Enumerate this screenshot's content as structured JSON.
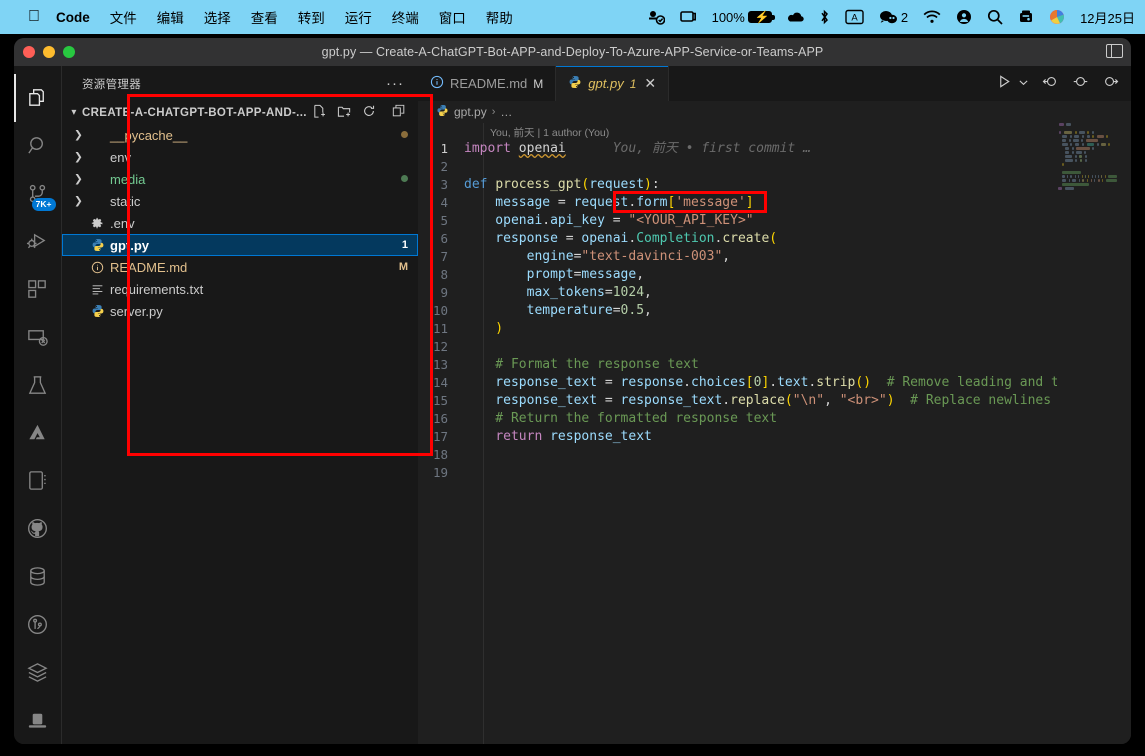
{
  "menubar": {
    "apple_icon": "apple-icon",
    "items": [
      "Code",
      "文件",
      "编辑",
      "选择",
      "查看",
      "转到",
      "运行",
      "终端",
      "窗口",
      "帮助"
    ],
    "status": {
      "control_center_icon": "control-center-icon",
      "display_icon": "display-icon",
      "battery_percent": "100%",
      "battery_icon": "battery-charging-icon",
      "dropbox_icon": "cloud-icon",
      "bluetooth_icon": "bluetooth-icon",
      "input_source": "A",
      "wechat_icon": "wechat-icon",
      "wechat_count": "2",
      "wifi_icon": "wifi-icon",
      "user_icon": "user-icon",
      "search_icon": "search-icon",
      "siri_icon": "siri-icon",
      "colorwheel_icon": "color-wheel-icon",
      "date": "12月25日"
    }
  },
  "window": {
    "title": "gpt.py — Create-A-ChatGPT-Bot-APP-and-Deploy-To-Azure-APP-Service-or-Teams-APP",
    "layout_icon": "editor-layout-icon"
  },
  "activitybar": {
    "items": [
      {
        "name": "explorer",
        "icon": "files-icon",
        "active": true,
        "badge": ""
      },
      {
        "name": "search",
        "icon": "search-icon",
        "active": false,
        "badge": ""
      },
      {
        "name": "source-control",
        "icon": "source-control-icon",
        "active": false,
        "badge": "7K+"
      },
      {
        "name": "run-and-debug",
        "icon": "debug-icon",
        "active": false,
        "badge": ""
      },
      {
        "name": "extensions",
        "icon": "extensions-icon",
        "active": false,
        "badge": ""
      },
      {
        "name": "remote-explorer",
        "icon": "remote-icon",
        "active": false,
        "badge": ""
      },
      {
        "name": "testing",
        "icon": "beaker-icon",
        "active": false,
        "badge": ""
      },
      {
        "name": "azure",
        "icon": "azure-icon",
        "active": false,
        "badge": ""
      },
      {
        "name": "notebook",
        "icon": "notebook-icon",
        "active": false,
        "badge": ""
      },
      {
        "name": "github",
        "icon": "github-icon",
        "active": false,
        "badge": ""
      },
      {
        "name": "database",
        "icon": "database-icon",
        "active": false,
        "badge": ""
      },
      {
        "name": "git-graph",
        "icon": "git-graph-icon",
        "active": false,
        "badge": ""
      },
      {
        "name": "layers",
        "icon": "layers-icon",
        "active": false,
        "badge": ""
      },
      {
        "name": "remote-desktop",
        "icon": "remote-desktop-icon",
        "active": false,
        "badge": ""
      }
    ]
  },
  "sidebar": {
    "title": "资源管理器",
    "more_actions": "···",
    "folder_name": "CREATE-A-CHATGPT-BOT-APP-AND-...",
    "folder_actions": [
      "new-file-icon",
      "new-folder-icon",
      "refresh-icon",
      "collapse-all-icon"
    ],
    "files": [
      {
        "label": "__pycache__",
        "type": "folder",
        "icon": "folder-arrow",
        "badge": "",
        "badge_kind": "dot-yellow",
        "selected": false,
        "color": "#e2c08d"
      },
      {
        "label": "env",
        "type": "folder",
        "icon": "folder-arrow",
        "badge": "",
        "badge_kind": "",
        "selected": false,
        "color": "#cccccc"
      },
      {
        "label": "media",
        "type": "folder",
        "icon": "folder-arrow",
        "badge": "",
        "badge_kind": "dot-green",
        "selected": false,
        "color": "#73c991"
      },
      {
        "label": "static",
        "type": "folder",
        "icon": "folder-arrow",
        "badge": "",
        "badge_kind": "",
        "selected": false,
        "color": "#cccccc"
      },
      {
        "label": ".env",
        "type": "file",
        "icon": "gear-icon",
        "badge": "",
        "badge_kind": "",
        "selected": false,
        "color": "#cccccc"
      },
      {
        "label": "gpt.py",
        "type": "file",
        "icon": "python-icon",
        "badge": "1",
        "badge_kind": "text",
        "selected": true,
        "color": "#ffffff"
      },
      {
        "label": "README.md",
        "type": "file",
        "icon": "info-icon",
        "badge": "M",
        "badge_kind": "text",
        "selected": false,
        "color": "#e2c08d"
      },
      {
        "label": "requirements.txt",
        "type": "file",
        "icon": "list-icon",
        "badge": "",
        "badge_kind": "",
        "selected": false,
        "color": "#cccccc"
      },
      {
        "label": "server.py",
        "type": "file",
        "icon": "python-icon",
        "badge": "",
        "badge_kind": "",
        "selected": false,
        "color": "#cccccc"
      }
    ]
  },
  "tabs": [
    {
      "label": "README.md",
      "icon": "info-icon",
      "status": "M",
      "active": false,
      "closable": false
    },
    {
      "label": "gpt.py",
      "icon": "python-icon",
      "status": "1",
      "active": true,
      "closable": true,
      "close_icon": "close-icon"
    }
  ],
  "tab_actions": [
    {
      "name": "run-python-file",
      "icon": "play-icon"
    },
    {
      "name": "run-dropdown",
      "icon": "chevron-down-icon"
    },
    {
      "name": "step-back",
      "icon": "step-back-icon"
    },
    {
      "name": "step-over",
      "icon": "step-over-icon"
    },
    {
      "name": "step-into",
      "icon": "step-into-icon"
    }
  ],
  "breadcrumb": {
    "file": "gpt.py",
    "separator": "›",
    "rest": "…",
    "icon": "python-icon"
  },
  "blame_header": "You, 前天 | 1 author (You)",
  "inline_blame": "You, 前天 • first commit …",
  "annotations": {
    "sidebar_box_color": "#ff0000",
    "apikey_box_color": "#ff0000"
  },
  "code": {
    "language": "python",
    "lines": [
      {
        "n": "1",
        "tokens": [
          {
            "t": "import",
            "c": "kw"
          },
          {
            "t": " ",
            "c": "plain"
          },
          {
            "t": "openai",
            "c": "squig-plain"
          }
        ],
        "blame": true
      },
      {
        "n": "2",
        "tokens": []
      },
      {
        "n": "3",
        "tokens": [
          {
            "t": "def",
            "c": "kw2"
          },
          {
            "t": " ",
            "c": "plain"
          },
          {
            "t": "process_gpt",
            "c": "fn"
          },
          {
            "t": "(",
            "c": "pun"
          },
          {
            "t": "request",
            "c": "var"
          },
          {
            "t": ")",
            "c": "pun"
          },
          {
            "t": ":",
            "c": "plain"
          }
        ]
      },
      {
        "n": "4",
        "tokens": [
          {
            "t": "    message",
            "c": "var"
          },
          {
            "t": " = ",
            "c": "plain"
          },
          {
            "t": "request",
            "c": "var"
          },
          {
            "t": ".",
            "c": "plain"
          },
          {
            "t": "form",
            "c": "var"
          },
          {
            "t": "[",
            "c": "pun"
          },
          {
            "t": "'message'",
            "c": "str"
          },
          {
            "t": "]",
            "c": "pun"
          }
        ]
      },
      {
        "n": "5",
        "tokens": [
          {
            "t": "    openai",
            "c": "var"
          },
          {
            "t": ".",
            "c": "plain"
          },
          {
            "t": "api_key",
            "c": "var"
          },
          {
            "t": " = ",
            "c": "plain"
          },
          {
            "t": "\"<YOUR_API_KEY>\"",
            "c": "str"
          }
        ]
      },
      {
        "n": "6",
        "tokens": [
          {
            "t": "    response",
            "c": "var"
          },
          {
            "t": " = ",
            "c": "plain"
          },
          {
            "t": "openai",
            "c": "var"
          },
          {
            "t": ".",
            "c": "plain"
          },
          {
            "t": "Completion",
            "c": "cls"
          },
          {
            "t": ".",
            "c": "plain"
          },
          {
            "t": "create",
            "c": "fn"
          },
          {
            "t": "(",
            "c": "pun"
          }
        ]
      },
      {
        "n": "7",
        "tokens": [
          {
            "t": "        engine",
            "c": "var"
          },
          {
            "t": "=",
            "c": "plain"
          },
          {
            "t": "\"text-davinci-003\"",
            "c": "str"
          },
          {
            "t": ",",
            "c": "plain"
          }
        ]
      },
      {
        "n": "8",
        "tokens": [
          {
            "t": "        prompt",
            "c": "var"
          },
          {
            "t": "=",
            "c": "plain"
          },
          {
            "t": "message",
            "c": "var"
          },
          {
            "t": ",",
            "c": "plain"
          }
        ]
      },
      {
        "n": "9",
        "tokens": [
          {
            "t": "        max_tokens",
            "c": "var"
          },
          {
            "t": "=",
            "c": "plain"
          },
          {
            "t": "1024",
            "c": "num"
          },
          {
            "t": ",",
            "c": "plain"
          }
        ]
      },
      {
        "n": "10",
        "tokens": [
          {
            "t": "        temperature",
            "c": "var"
          },
          {
            "t": "=",
            "c": "plain"
          },
          {
            "t": "0.5",
            "c": "num"
          },
          {
            "t": ",",
            "c": "plain"
          }
        ]
      },
      {
        "n": "11",
        "tokens": [
          {
            "t": "    )",
            "c": "pun"
          }
        ]
      },
      {
        "n": "12",
        "tokens": []
      },
      {
        "n": "13",
        "tokens": [
          {
            "t": "    # Format the response text",
            "c": "cmt"
          }
        ]
      },
      {
        "n": "14",
        "tokens": [
          {
            "t": "    response_text",
            "c": "var"
          },
          {
            "t": " = ",
            "c": "plain"
          },
          {
            "t": "response",
            "c": "var"
          },
          {
            "t": ".",
            "c": "plain"
          },
          {
            "t": "choices",
            "c": "var"
          },
          {
            "t": "[",
            "c": "pun"
          },
          {
            "t": "0",
            "c": "num"
          },
          {
            "t": "]",
            "c": "pun"
          },
          {
            "t": ".",
            "c": "plain"
          },
          {
            "t": "text",
            "c": "var"
          },
          {
            "t": ".",
            "c": "plain"
          },
          {
            "t": "strip",
            "c": "fn"
          },
          {
            "t": "()",
            "c": "pun"
          },
          {
            "t": "  # Remove leading and trailing whitespace",
            "c": "cmt"
          }
        ]
      },
      {
        "n": "15",
        "tokens": [
          {
            "t": "    response_text",
            "c": "var"
          },
          {
            "t": " = ",
            "c": "plain"
          },
          {
            "t": "response_text",
            "c": "var"
          },
          {
            "t": ".",
            "c": "plain"
          },
          {
            "t": "replace",
            "c": "fn"
          },
          {
            "t": "(",
            "c": "pun"
          },
          {
            "t": "\"\\n\"",
            "c": "str"
          },
          {
            "t": ", ",
            "c": "plain"
          },
          {
            "t": "\"<br>\"",
            "c": "str"
          },
          {
            "t": ")",
            "c": "pun"
          },
          {
            "t": "  # Replace newlines with line breaks",
            "c": "cmt"
          }
        ]
      },
      {
        "n": "16",
        "tokens": [
          {
            "t": "    # Return the formatted response text",
            "c": "cmt"
          }
        ]
      },
      {
        "n": "17",
        "tokens": [
          {
            "t": "    ",
            "c": "plain"
          },
          {
            "t": "return",
            "c": "kw"
          },
          {
            "t": " ",
            "c": "plain"
          },
          {
            "t": "response_text",
            "c": "var"
          }
        ]
      },
      {
        "n": "18",
        "tokens": []
      },
      {
        "n": "19",
        "tokens": []
      }
    ]
  }
}
